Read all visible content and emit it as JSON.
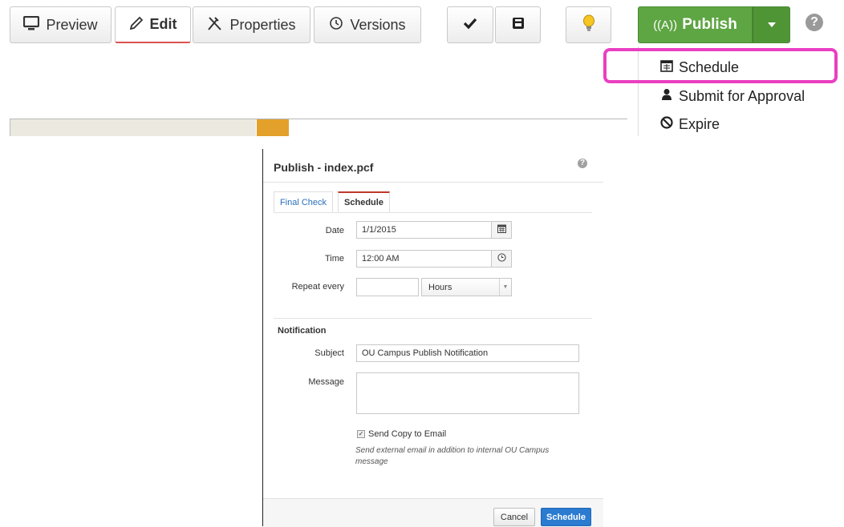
{
  "toolbar": {
    "preview": "Preview",
    "edit": "Edit",
    "properties": "Properties",
    "versions": "Versions",
    "publish": "Publish",
    "help": "?"
  },
  "icons": {
    "preview": "monitor-icon",
    "edit": "pencil-icon",
    "properties": "tools-icon",
    "versions": "history-icon",
    "check": "checkmark-icon",
    "save": "save-icon",
    "lightbulb": "lightbulb-icon",
    "publish": "broadcast-icon",
    "schedule": "calendar-icon",
    "approval": "user-icon",
    "expire": "ban-icon"
  },
  "publish_menu": {
    "items": [
      {
        "label": "Schedule"
      },
      {
        "label": "Submit for Approval"
      },
      {
        "label": "Expire"
      }
    ]
  },
  "dialog": {
    "title": "Publish - index.pcf",
    "help": "?",
    "tabs": [
      {
        "label": "Final Check",
        "active": false
      },
      {
        "label": "Schedule",
        "active": true
      }
    ],
    "date_label": "Date",
    "date_value": "1/1/2015",
    "time_label": "Time",
    "time_value": "12:00 AM",
    "repeat_label": "Repeat every",
    "repeat_value": "",
    "repeat_unit": "Hours",
    "notification_heading": "Notification",
    "subject_label": "Subject",
    "subject_value": "OU Campus Publish Notification",
    "message_label": "Message",
    "message_value": "",
    "send_copy_label": "Send Copy to Email",
    "send_copy_checked": true,
    "send_copy_help": "Send external email in addition to internal OU Campus message",
    "cancel_label": "Cancel",
    "schedule_label": "Schedule"
  },
  "colors": {
    "publish_green": "#5ea543",
    "highlight_magenta": "#ea3fc1",
    "primary_blue": "#2b7bd0",
    "active_tab_red": "#c0392b",
    "strip_orange": "#e3a02b"
  }
}
